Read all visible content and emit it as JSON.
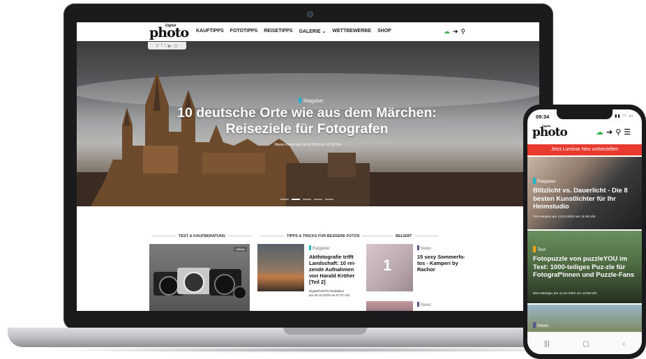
{
  "desktop": {
    "logo": {
      "small": "Digital",
      "main": "photo"
    },
    "nav": [
      "KAUFTIPPS",
      "FOTOTIPPS",
      "REISETIPPS",
      "GALERIE ⌄",
      "WETTBEWERBE",
      "SHOP"
    ],
    "header_icons": {
      "upload": "cloud-upload-icon",
      "login": "sign-in-icon",
      "search": "search-icon"
    },
    "social": [
      "p",
      "f",
      "t",
      "▶",
      "◎"
    ],
    "hero": {
      "category": "Ratgeber",
      "title_line1": "10 deutsche Orte wie aus dem Märchen:",
      "title_line2": "Reiseziele für Fotografen",
      "meta": "Maren Kirsch am 04.10.2019 um 11:02 Uhr"
    },
    "sections": [
      "TEST & KAUFBERATUNG",
      "TIPPS & TRICKS FÜR BESSERE FOTOS",
      "BELIEBT"
    ],
    "card1_badge": "Affiliate",
    "article2": {
      "category": "Ratgeber",
      "title": "Aktfotografie trifft Landschaft: 10 rei-zende Aufnahmen von Harald Kröher [Teil 2]",
      "author": "DigitalPHOTO-Redaktion",
      "date": "am 05.10.2019 um 07:37 Uhr"
    },
    "article3": {
      "category": "News",
      "number": "1",
      "title": "15 sexy Sommerfo-tos - Kamperi by Rachor"
    },
    "article4": {
      "category": "News"
    },
    "colors": {
      "ratgeber": "#1fb5c9",
      "news": "#555a8c",
      "test": "#f2a21b",
      "banner": "#e83a2e"
    }
  },
  "mobile": {
    "time": "09:34",
    "status": "▮▮ ◠ ▭",
    "logo": {
      "small": "Digital",
      "main": "photo"
    },
    "banner": "Jetzt Luminar Neo vorbestellen",
    "cards": [
      {
        "category": "Ratgeber",
        "title": "Blitzlicht vs. Dauerlicht - Die 8 besten Kunstlichter für Ihr Heimstudio",
        "meta": "Tim Herpers am 13.01.2022 um 11:45 Uhr"
      },
      {
        "category": "Test",
        "title": "Fotopuzzle von puzzleYOU im Test: 1000-teiliges Puz-zle für Fotograf*innen und Puzzle-Fans",
        "meta": "Nico Metzger am 11.01.2022 um 13:55 Uhr"
      },
      {
        "category": "News"
      }
    ],
    "nav": [
      "|||",
      "▢",
      "‹"
    ]
  }
}
